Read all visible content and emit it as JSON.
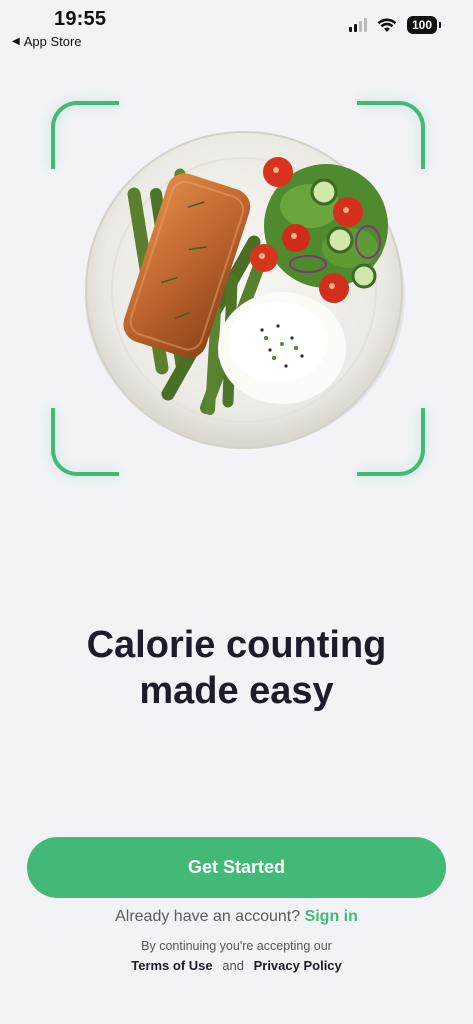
{
  "status_bar": {
    "time": "19:55",
    "back_label": "App Store",
    "battery": "100",
    "icons": [
      "signal-icon",
      "wifi-icon",
      "battery-icon"
    ]
  },
  "hero": {
    "image_subject": "plate with salmon, asparagus, rice and tomato cucumber salad",
    "frame_color": "#43b978"
  },
  "headline": {
    "line1": "Calorie counting",
    "line2": "made easy"
  },
  "cta": {
    "label": "Get Started",
    "color": "#43b978"
  },
  "signin": {
    "prompt": "Already have an account?",
    "link": "Sign in"
  },
  "legal": {
    "intro": "By continuing you're accepting our",
    "terms": "Terms of Use",
    "and": "and",
    "privacy": "Privacy Policy"
  }
}
